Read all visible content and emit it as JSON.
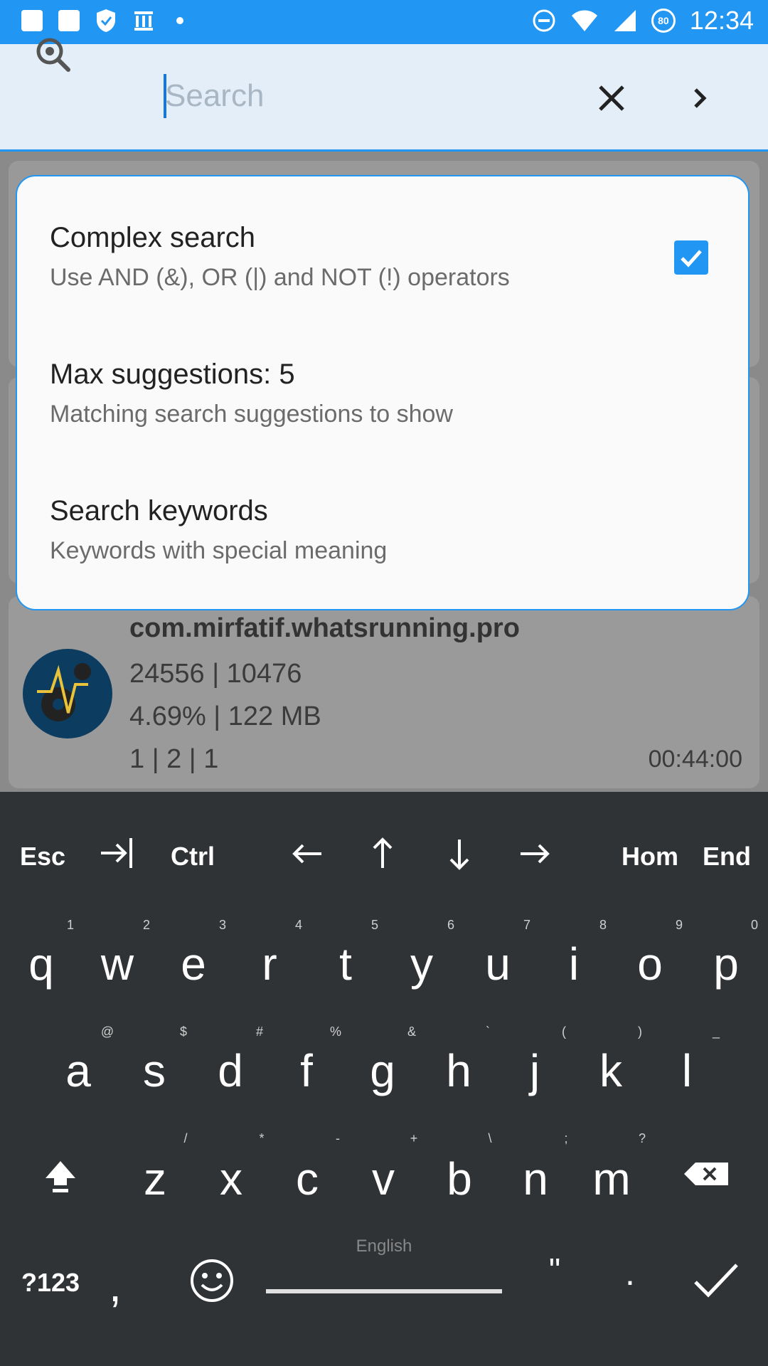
{
  "status_bar": {
    "time": "12:34",
    "battery_level": "80",
    "left_icons": [
      "notes-icon",
      "notes-icon",
      "shield-check-icon",
      "bank-icon",
      "dot-icon"
    ],
    "right_icons": [
      "do-not-disturb-icon",
      "wifi-icon",
      "signal-icon",
      "battery-icon"
    ]
  },
  "search_bar": {
    "placeholder": "Search",
    "value": "",
    "icons": [
      "search-settings-icon",
      "clear-icon",
      "chevron-right-icon"
    ]
  },
  "popup": {
    "options": [
      {
        "title": "Complex search",
        "subtitle": "Use AND (&), OR (|) and NOT (!) operators",
        "checked": true
      },
      {
        "title": "Max suggestions: 5",
        "subtitle": "Matching search suggestions to show"
      },
      {
        "title": "Search keywords",
        "subtitle": "Keywords with special meaning"
      }
    ]
  },
  "app_card": {
    "package": "com.mirfatif.whatsrunning.pro",
    "line2": "24556 | 10476",
    "line3": "4.69% | 122 MB",
    "line4": "1 | 2 | 1",
    "time": "00:44:00"
  },
  "keyboard": {
    "top_row": {
      "esc": "Esc",
      "ctrl": "Ctrl",
      "home": "Hom",
      "end": "End"
    },
    "row1": [
      "q",
      "w",
      "e",
      "r",
      "t",
      "y",
      "u",
      "i",
      "o",
      "p"
    ],
    "row1_hints": [
      "1",
      "2",
      "3",
      "4",
      "5",
      "6",
      "7",
      "8",
      "9",
      "0"
    ],
    "row2": [
      "a",
      "s",
      "d",
      "f",
      "g",
      "h",
      "j",
      "k",
      "l"
    ],
    "row2_hints": [
      "@",
      "$",
      "#",
      "%",
      "&",
      "`",
      "(",
      ")",
      "_"
    ],
    "row3": [
      "z",
      "x",
      "c",
      "v",
      "b",
      "n",
      "m"
    ],
    "row3_hints": [
      "/",
      "*",
      "-",
      "+",
      "\\",
      ";",
      "?"
    ],
    "bottom": {
      "symbols": "?123",
      "comma": ",",
      "space_label": "English",
      "quote": "\"",
      "period": "."
    }
  },
  "colors": {
    "accent": "#2196f3",
    "keyboard_bg": "#303336"
  }
}
